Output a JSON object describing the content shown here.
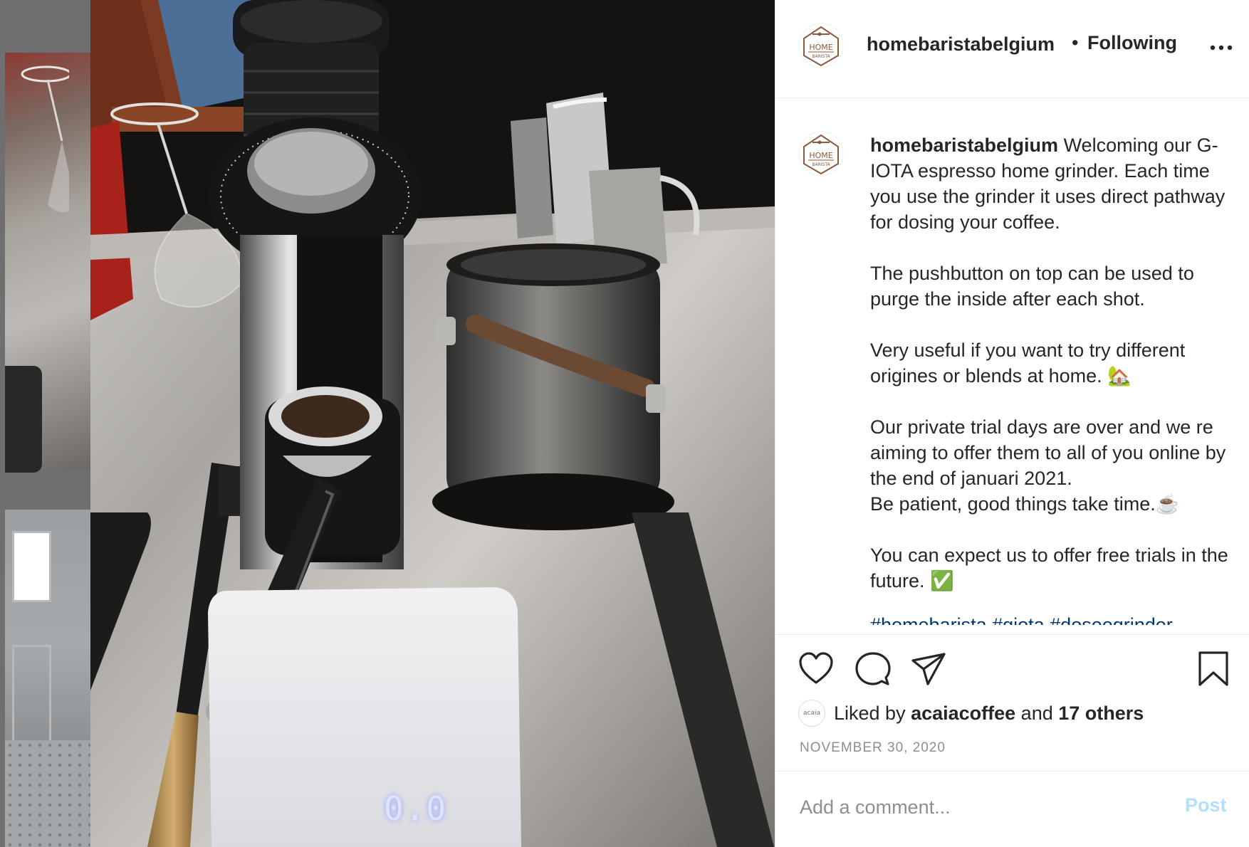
{
  "header": {
    "avatar_icon": "home-barista-logo",
    "username": "homebaristabelgium",
    "separator": "•",
    "follow_status": "Following",
    "more_icon": "more-horizontal-icon"
  },
  "photo": {
    "scale_display": "0.0"
  },
  "caption": {
    "username": "homebaristabelgium",
    "text": " Welcoming our G-IOTA espresso home grinder. Each time you use the grinder it uses direct pathway for dosing your coffee.\n\nThe pushbutton on top can be used to purge the inside after each shot.\n\nVery useful if you want to try different origines or blends at home. 🏡\n\nOur private trial days are over and we re aiming to offer them to all of you online by the end of januari 2021.\nBe patient, good things take time.☕\n\nYou can expect us to offer free trials in the future. ✅",
    "hashtags": "#homebarista #giota #doseegrinder"
  },
  "actions": {
    "like_icon": "heart-icon",
    "comment_icon": "comment-icon",
    "share_icon": "paper-plane-icon",
    "save_icon": "bookmark-icon"
  },
  "likes": {
    "liker_avatar_text": "acaia",
    "prefix": "Liked by ",
    "liker": "acaiacoffee",
    "middle": " and ",
    "others": "17 others"
  },
  "date": "NOVEMBER 30, 2020",
  "comment": {
    "placeholder": "Add a comment...",
    "post_label": "Post"
  },
  "colors": {
    "text": "#262626",
    "secondary": "#8e8e8e",
    "post_button_disabled": "#b2dffc",
    "hashtag": "#00376b",
    "logo_brown": "#8b5a3c"
  }
}
